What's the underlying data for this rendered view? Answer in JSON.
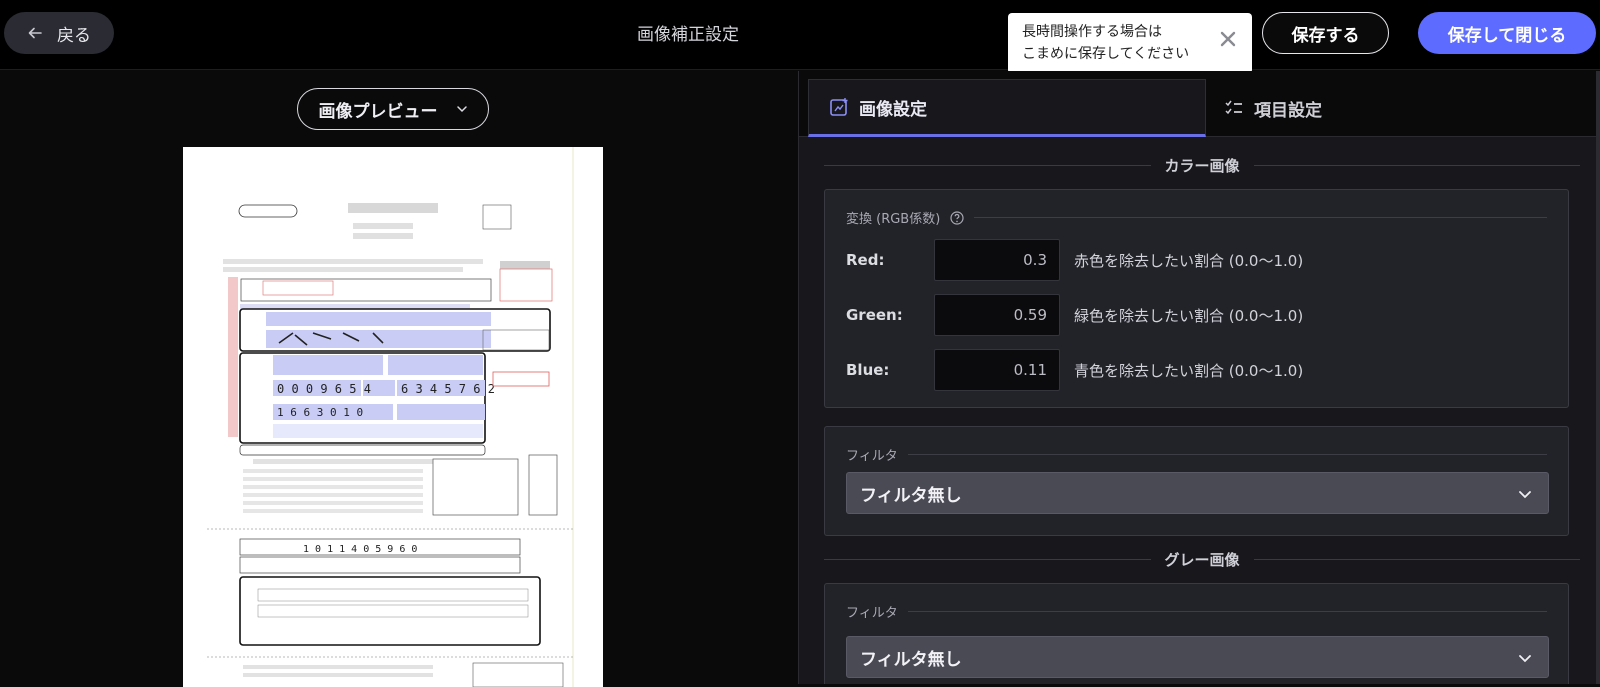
{
  "header": {
    "back_label": "戻る",
    "title": "画像補正設定",
    "toast_text_line1": "長時間操作する場合は",
    "toast_text_line2": "こまめに保存してください",
    "save_label": "保存する",
    "save_close_label": "保存して閉じる"
  },
  "preview": {
    "select_label": "画像プレビュー"
  },
  "tabs": [
    {
      "label": "画像設定",
      "icon": "image-settings-icon",
      "active": true
    },
    {
      "label": "項目設定",
      "icon": "checklist-icon",
      "active": false
    }
  ],
  "color_section": {
    "heading": "カラー画像",
    "conversion": {
      "label": "変換 (RGB係数)",
      "rows": [
        {
          "name": "Red:",
          "value": "0.3",
          "desc": "赤色を除去したい割合 (0.0〜1.0)"
        },
        {
          "name": "Green:",
          "value": "0.59",
          "desc": "緑色を除去したい割合 (0.0〜1.0)"
        },
        {
          "name": "Blue:",
          "value": "0.11",
          "desc": "青色を除去したい割合 (0.0〜1.0)"
        }
      ]
    },
    "filter": {
      "label": "フィルタ",
      "selected": "フィルタ無し"
    }
  },
  "gray_section": {
    "heading": "グレー画像",
    "filter": {
      "label": "フィルタ",
      "selected": "フィルタ無し"
    }
  },
  "colors": {
    "accent": "#5e6bff",
    "tab_underline": "#6a6fe8",
    "background": "#0a0a0b",
    "panel": "#17171c",
    "card": "#222229"
  }
}
